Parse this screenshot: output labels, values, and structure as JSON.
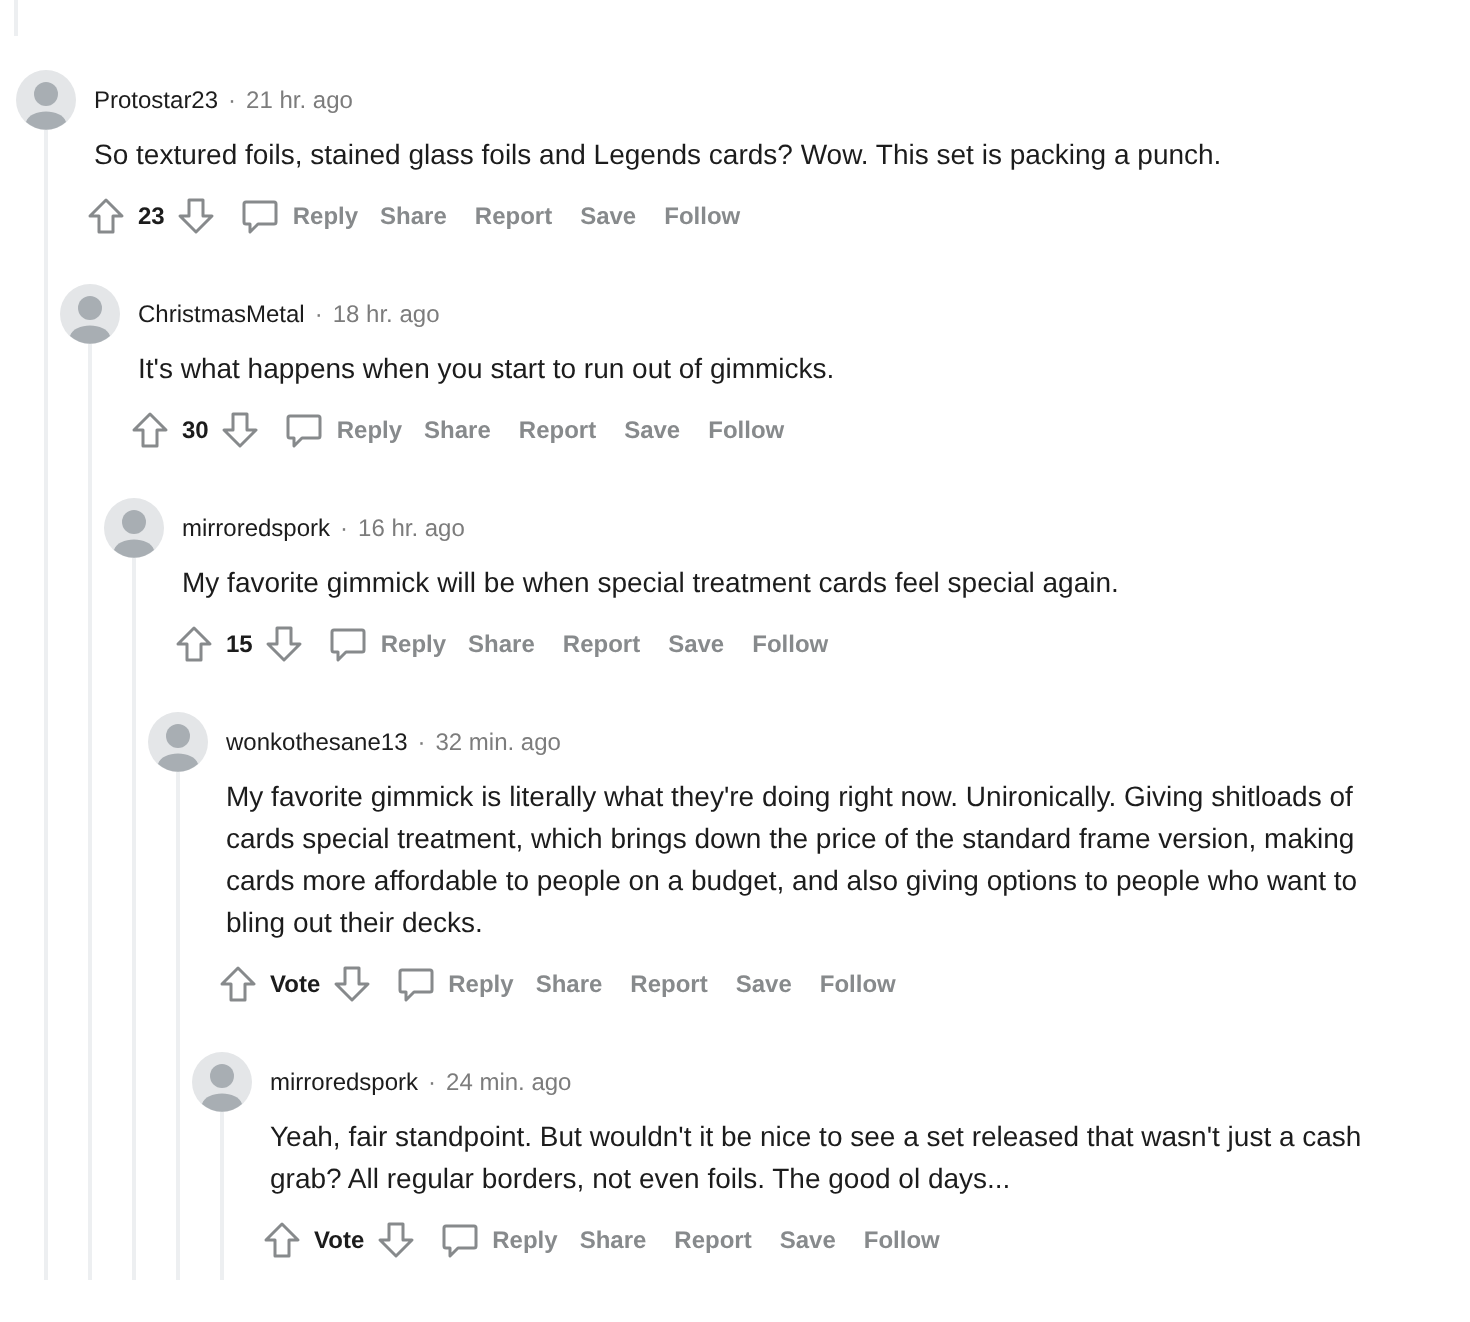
{
  "comments": [
    {
      "author": "Protostar23",
      "separator": "·",
      "time": "21 hr. ago",
      "body": "So textured foils, stained glass foils and Legends cards? Wow. This set is packing a punch.",
      "score": "23",
      "actions": [
        {
          "label": "Reply",
          "kind": "reply"
        },
        {
          "label": "Share",
          "kind": "plain"
        },
        {
          "label": "Report",
          "kind": "plain"
        },
        {
          "label": "Save",
          "kind": "plain"
        },
        {
          "label": "Follow",
          "kind": "plain"
        }
      ],
      "children": [
        {
          "author": "ChristmasMetal",
          "separator": "·",
          "time": "18 hr. ago",
          "body": "It's what happens when you start to run out of gimmicks.",
          "score": "30",
          "actions": [
            {
              "label": "Reply",
              "kind": "reply"
            },
            {
              "label": "Share",
              "kind": "plain"
            },
            {
              "label": "Report",
              "kind": "plain"
            },
            {
              "label": "Save",
              "kind": "plain"
            },
            {
              "label": "Follow",
              "kind": "plain"
            }
          ],
          "children": [
            {
              "author": "mirroredspork",
              "separator": "·",
              "time": "16 hr. ago",
              "body": "My favorite gimmick will be when special treatment cards feel special again.",
              "score": "15",
              "actions": [
                {
                  "label": "Reply",
                  "kind": "reply"
                },
                {
                  "label": "Share",
                  "kind": "plain"
                },
                {
                  "label": "Report",
                  "kind": "plain"
                },
                {
                  "label": "Save",
                  "kind": "plain"
                },
                {
                  "label": "Follow",
                  "kind": "plain"
                }
              ],
              "children": [
                {
                  "author": "wonkothesane13",
                  "separator": "·",
                  "time": "32 min. ago",
                  "body": "My favorite gimmick is literally what they're doing right now. Unironically. Giving shitloads of cards special treatment, which brings down the price of the standard frame version, making cards more affordable to people on a budget, and also giving options to people who want to bling out their decks.",
                  "score": "Vote",
                  "actions": [
                    {
                      "label": "Reply",
                      "kind": "reply"
                    },
                    {
                      "label": "Share",
                      "kind": "plain"
                    },
                    {
                      "label": "Report",
                      "kind": "plain"
                    },
                    {
                      "label": "Save",
                      "kind": "plain"
                    },
                    {
                      "label": "Follow",
                      "kind": "plain"
                    }
                  ],
                  "children": [
                    {
                      "author": "mirroredspork",
                      "separator": "·",
                      "time": "24 min. ago",
                      "body": "Yeah, fair standpoint. But wouldn't it be nice to see a set released that wasn't just a cash grab? All regular borders, not even foils. The good ol days...",
                      "score": "Vote",
                      "actions": [
                        {
                          "label": "Reply",
                          "kind": "reply"
                        },
                        {
                          "label": "Share",
                          "kind": "plain"
                        },
                        {
                          "label": "Report",
                          "kind": "plain"
                        },
                        {
                          "label": "Save",
                          "kind": "plain"
                        },
                        {
                          "label": "Follow",
                          "kind": "plain"
                        }
                      ]
                    }
                  ]
                }
              ]
            }
          ]
        }
      ]
    }
  ]
}
